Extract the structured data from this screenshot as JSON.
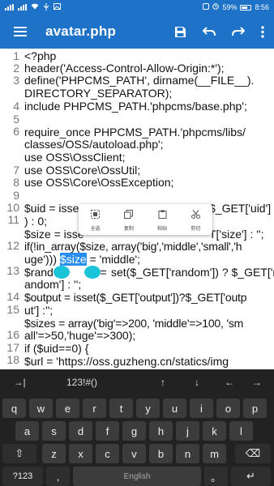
{
  "status": {
    "time": "8:56",
    "battery": "59%"
  },
  "appbar": {
    "title": "avatar.php"
  },
  "context_menu": [
    {
      "label": "全选",
      "icon": "select-all-icon"
    },
    {
      "label": "复制",
      "icon": "copy-icon"
    },
    {
      "label": "粘贴",
      "icon": "paste-icon"
    },
    {
      "label": "剪切",
      "icon": "cut-icon"
    }
  ],
  "editor": {
    "line_numbers": [
      "1",
      "2",
      "3",
      "4",
      "5",
      "6",
      "7",
      "8",
      "9",
      "10",
      "11",
      "12",
      "13",
      "14",
      "15",
      "16",
      "17",
      "18"
    ],
    "rows": [
      "<?php",
      "header('Access-Control-Allow-Origin:*');",
      "define('PHPCMS_PATH', dirname(__FILE__).",
      "DIRECTORY_SEPARATOR);",
      "include PHPCMS_PATH.'phpcms/base.php';",
      "",
      "require_once PHPCMS_PATH.'phpcms/libs/",
      "classes/OSS/autoload.php';",
      "use OSS\\OssClient;",
      "use OSS\\Core\\OssUtil;",
      "use OSS\\Core\\OssException;",
      "",
      "$uid = isse",
      "$_GET['uid']",
      ") : 0;",
      "$size = isse",
      "T['size'] : '';",
      "if(!in_array($size, array('big','middle','small','h",
      "uge'))) ",
      "$size",
      " = 'middle';",
      "$rand",
      "m = ",
      "set($_GET['random']) ? $_GET['r",
      "andom'] : '';",
      "$output = isset($_GET['output'])?$_GET['outp",
      "ut'] :'';",
      "$sizes = array('big'=>200, 'middle'=>100, 'sm",
      "all'=>50,'huge'=>300);",
      "if ($uid==0) {",
      "    $url = 'https://oss.guzheng.cn/statics/img"
    ]
  },
  "keyboard": {
    "fn_row": [
      "→|",
      "123!#()",
      "↑",
      "↓",
      "←",
      "→"
    ],
    "row1": [
      "q",
      "w",
      "e",
      "r",
      "t",
      "y",
      "u",
      "i",
      "o",
      "p"
    ],
    "row2": [
      "a",
      "s",
      "d",
      "f",
      "g",
      "h",
      "j",
      "k",
      "l"
    ],
    "row3": [
      "⇧",
      "z",
      "x",
      "c",
      "v",
      "b",
      "n",
      "m",
      "⌫"
    ],
    "row4": [
      "?123",
      ",",
      "English",
      "。",
      "↵"
    ]
  }
}
